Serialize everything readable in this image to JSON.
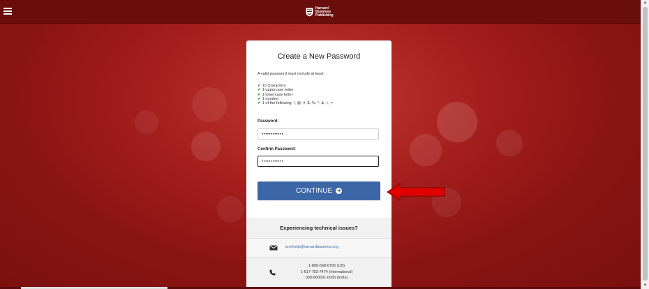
{
  "header": {
    "menu_icon": "hamburger-icon",
    "logo_lines": [
      "Harvard",
      "Business",
      "Publishing"
    ]
  },
  "card": {
    "title": "Create a New Password",
    "intro": "A valid password must include at least:",
    "requirements": [
      "10 characters",
      "1 uppercase letter",
      "1 lowercase letter",
      "1 number",
      "1 of the following: !, @, #, $, %, ^, &, +, ="
    ],
    "password_label": "Password:",
    "password_value": "••••••••••••",
    "confirm_label": "Confirm Password:",
    "confirm_value": "••••••••••••",
    "continue_label": "CONTINUE",
    "continue_icon": "arrow-circle-right-icon"
  },
  "support": {
    "heading": "Experiencing technical issues?",
    "email": "techhelp@harvardbusiness.org",
    "phones": [
      "1-800-668-6705 (US)",
      "1-617-783-7474 (International)",
      "000-800001-6935 (India)"
    ]
  },
  "colors": {
    "background_red": "#8e1414",
    "topbar": "#6a0d0d",
    "button_blue": "#3c66a5",
    "check_green": "#2e8b2e",
    "callout_red": "#e00000"
  }
}
